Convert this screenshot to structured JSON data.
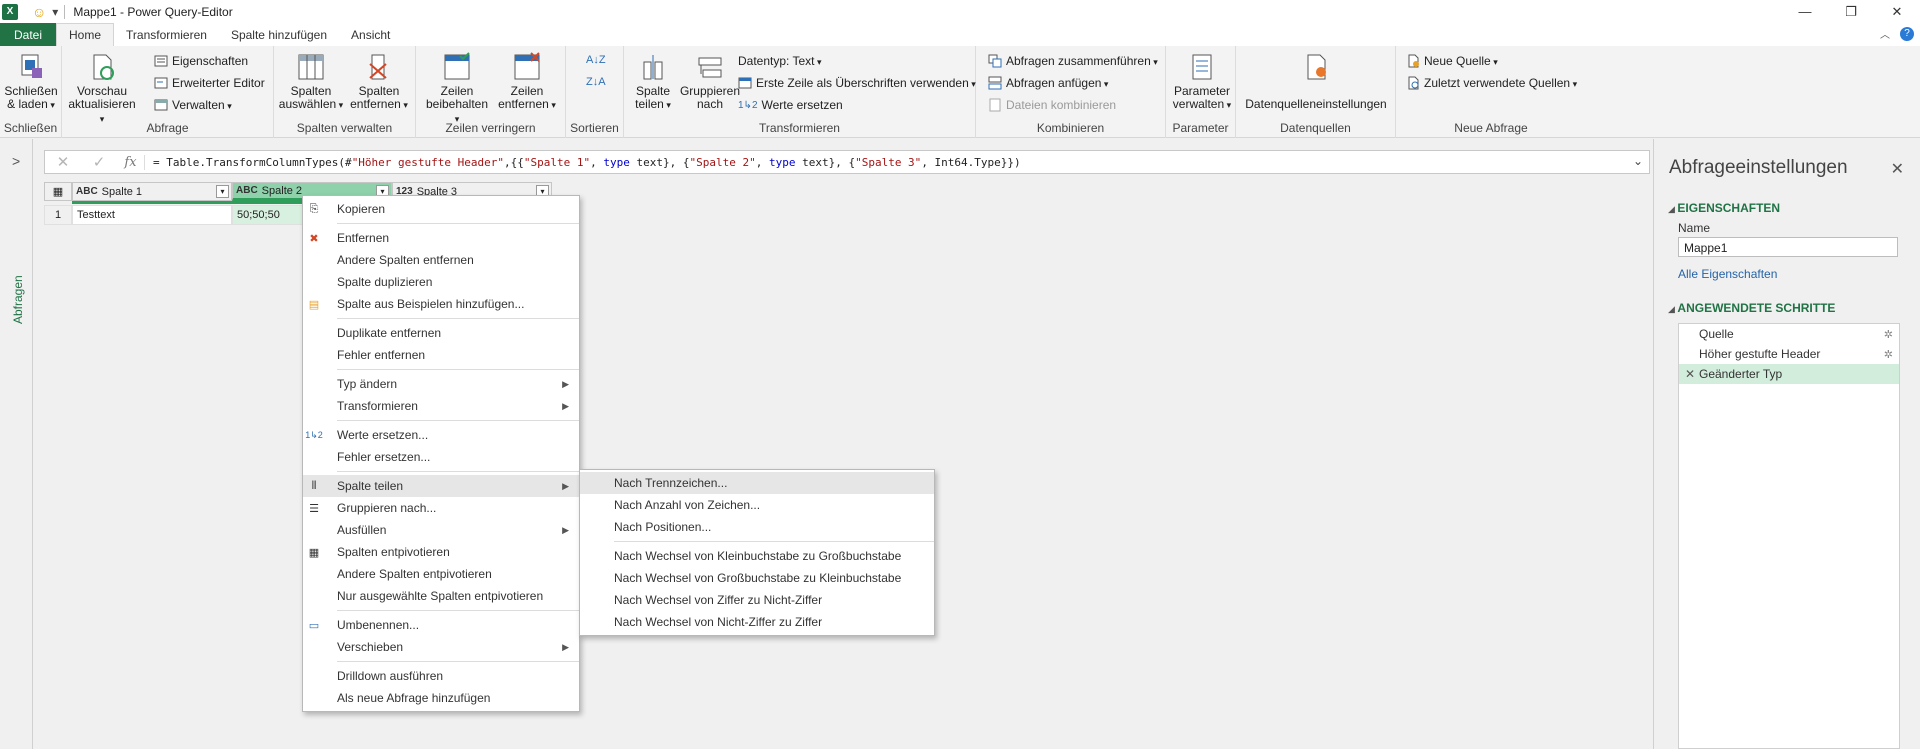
{
  "window": {
    "title": "Mappe1 - Power Query-Editor",
    "app_icon": "X",
    "controls": [
      "—",
      "❐",
      "✕"
    ]
  },
  "tabs": [
    "Datei",
    "Home",
    "Transformieren",
    "Spalte hinzufügen",
    "Ansicht"
  ],
  "ribbon": {
    "schliessen": {
      "btn": "Schließen\n& laden",
      "group": "Schließen"
    },
    "abfrage": {
      "vorschau": "Vorschau\naktualisieren",
      "eigenschaften": "Eigenschaften",
      "erweiterter_editor": "Erweiterter Editor",
      "verwalten": "Verwalten",
      "group": "Abfrage"
    },
    "spalten_verwalten": {
      "auswaehlen": "Spalten\nauswählen",
      "entfernen": "Spalten\nentfernen",
      "group": "Spalten verwalten"
    },
    "zeilen_verringern": {
      "beibehalten": "Zeilen\nbeibehalten",
      "entfernen": "Zeilen\nentfernen",
      "group": "Zeilen verringern"
    },
    "sortieren": {
      "group": "Sortieren"
    },
    "transformieren": {
      "spalte_teilen": "Spalte\nteilen",
      "gruppieren": "Gruppieren\nnach",
      "datentyp": "Datentyp: Text",
      "erste_zeile": "Erste Zeile als Überschriften verwenden",
      "werte_ersetzen": "Werte ersetzen",
      "group": "Transformieren"
    },
    "kombinieren": {
      "zusammenfuehren": "Abfragen zusammenführen",
      "anfuegen": "Abfragen anfügen",
      "dateien": "Dateien kombinieren",
      "group": "Kombinieren"
    },
    "parameter": {
      "btn": "Parameter\nverwalten",
      "group": "Parameter"
    },
    "datenquellen": {
      "btn": "Datenquelleneinstellungen",
      "group": "Datenquellen"
    },
    "neue_abfrage": {
      "neue_quelle": "Neue Quelle",
      "zuletzt": "Zuletzt verwendete Quellen",
      "group": "Neue Abfrage"
    }
  },
  "nav": {
    "label": "Abfragen"
  },
  "formula": {
    "p1": "= Table.TransformColumnTypes(#",
    "s1": "\"Höher gestufte Header\"",
    "p2": ",{{",
    "s2": "\"Spalte 1\"",
    "p3": ", ",
    "k1": "type",
    "p4": " text}, {",
    "s3": "\"Spalte 2\"",
    "p5": ", ",
    "k2": "type",
    "p6": " text}, {",
    "s4": "\"Spalte 3\"",
    "p7": ", Int64.Type}})"
  },
  "grid": {
    "columns": [
      {
        "type": "ABC",
        "name": "Spalte 1"
      },
      {
        "type": "ABC",
        "name": "Spalte 2"
      },
      {
        "type": "123",
        "name": "Spalte 3"
      }
    ],
    "row_num": "1",
    "row": [
      "Testtext",
      "50;50;50"
    ]
  },
  "settings": {
    "title": "Abfrageeinstellungen",
    "eigenschaften": "EIGENSCHAFTEN",
    "name_label": "Name",
    "name_value": "Mappe1",
    "alle_eigenschaften": "Alle Eigenschaften",
    "steps_header": "ANGEWENDETE SCHRITTE",
    "steps": [
      "Quelle",
      "Höher gestufte Header",
      "Geänderter Typ"
    ]
  },
  "context_menu": [
    "Kopieren",
    "Entfernen",
    "Andere Spalten entfernen",
    "Spalte duplizieren",
    "Spalte aus Beispielen hinzufügen...",
    "Duplikate entfernen",
    "Fehler entfernen",
    "Typ ändern",
    "Transformieren",
    "Werte ersetzen...",
    "Fehler ersetzen...",
    "Spalte teilen",
    "Gruppieren nach...",
    "Ausfüllen",
    "Spalten entpivotieren",
    "Andere Spalten entpivotieren",
    "Nur ausgewählte Spalten entpivotieren",
    "Umbenennen...",
    "Verschieben",
    "Drilldown ausführen",
    "Als neue Abfrage hinzufügen"
  ],
  "submenu": [
    "Nach Trennzeichen...",
    "Nach Anzahl von Zeichen...",
    "Nach Positionen...",
    "Nach Wechsel von Kleinbuchstabe zu Großbuchstabe",
    "Nach Wechsel von Großbuchstabe zu Kleinbuchstabe",
    "Nach Wechsel von Ziffer zu Nicht-Ziffer",
    "Nach Wechsel von Nicht-Ziffer zu Ziffer"
  ]
}
